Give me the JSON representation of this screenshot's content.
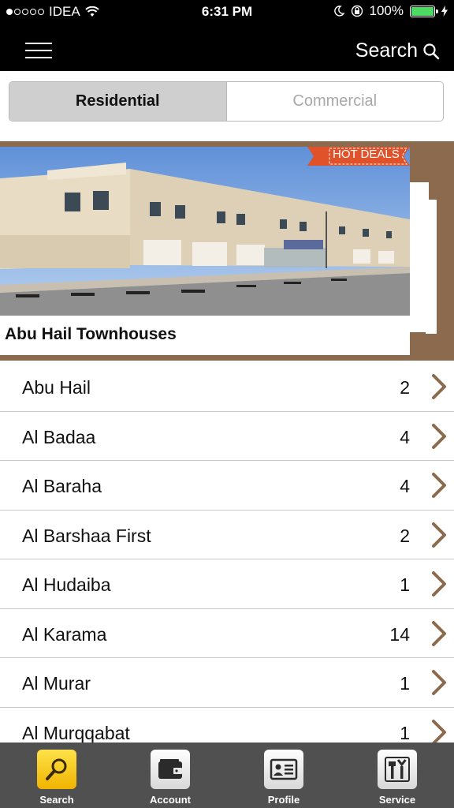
{
  "status": {
    "carrier": "IDEA",
    "time": "6:31 PM",
    "battery": "100%",
    "signal_bars": 1,
    "signal_total": 5
  },
  "nav": {
    "search_label": "Search"
  },
  "segment": {
    "options": [
      "Residential",
      "Commercial"
    ],
    "selected": "Residential"
  },
  "banner": {
    "badge": "HOT DEALS",
    "title": "Abu Hail Townhouses"
  },
  "areas": [
    {
      "name": "Abu Hail",
      "count": "2"
    },
    {
      "name": "Al Badaa",
      "count": "4"
    },
    {
      "name": "Al Baraha",
      "count": "4"
    },
    {
      "name": "Al Barshaa First",
      "count": "2"
    },
    {
      "name": "Al Hudaiba",
      "count": "1"
    },
    {
      "name": "Al Karama",
      "count": "14"
    },
    {
      "name": "Al Murar",
      "count": "1"
    },
    {
      "name": "Al Murqqabat",
      "count": "1"
    }
  ],
  "tabs": [
    {
      "label": "Search",
      "icon": "magnifier-icon",
      "active": true
    },
    {
      "label": "Account",
      "icon": "wallet-icon",
      "active": false
    },
    {
      "label": "Profile",
      "icon": "id-card-icon",
      "active": false
    },
    {
      "label": "Service",
      "icon": "tools-icon",
      "active": false
    }
  ],
  "colors": {
    "banner_bg": "#8b6a4e",
    "chevron": "#8b6a4e",
    "hot_badge": "#e0522a",
    "battery": "#4cd964",
    "active_tab": "#f4c20d"
  }
}
